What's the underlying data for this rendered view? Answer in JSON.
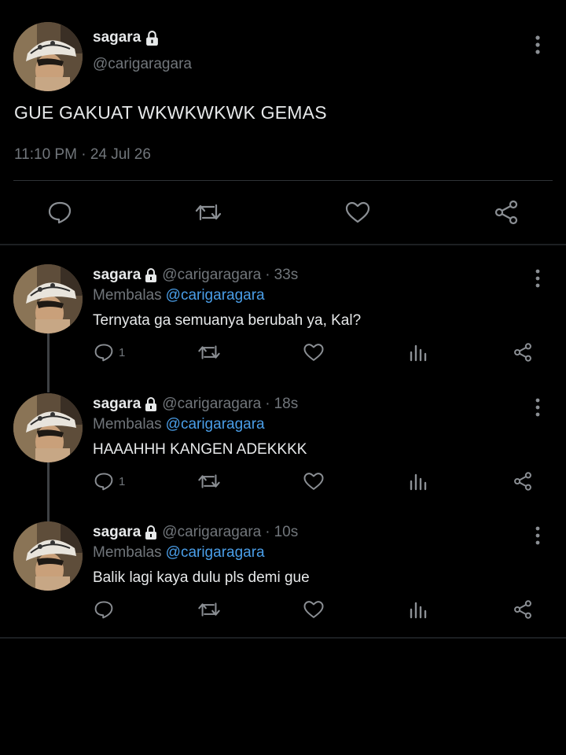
{
  "main_tweet": {
    "name": "sagara",
    "handle": "@carigaragara",
    "text": "GUE GAKUAT WKWKWKWK GEMAS",
    "time": "11:10 PM",
    "separator": "·",
    "date": "24 Jul 26",
    "actions": [
      "reply-icon",
      "retweet-icon",
      "like-icon",
      "share-icon"
    ]
  },
  "replies": [
    {
      "name": "sagara",
      "handle": "@carigaragara",
      "dot": "·",
      "time": "33s",
      "replying_label": "Membalas",
      "replying_to": "@carigaragara",
      "text": "Ternyata ga semuanya berubah ya, Kal?",
      "reply_count": "1"
    },
    {
      "name": "sagara",
      "handle": "@carigaragara",
      "dot": "·",
      "time": "18s",
      "replying_label": "Membalas",
      "replying_to": "@carigaragara",
      "text": "HAAAHHH KANGEN ADEKKKK",
      "reply_count": "1"
    },
    {
      "name": "sagara",
      "handle": "@carigaragara",
      "dot": "·",
      "time": "10s",
      "replying_label": "Membalas",
      "replying_to": "@carigaragara",
      "text": "Balik lagi kaya dulu pls demi gue",
      "reply_count": ""
    }
  ],
  "colors": {
    "background": "#000000",
    "text": "#e7e9ea",
    "muted": "#71767b",
    "mention": "#4a9ee8",
    "divider": "#2f3336"
  }
}
